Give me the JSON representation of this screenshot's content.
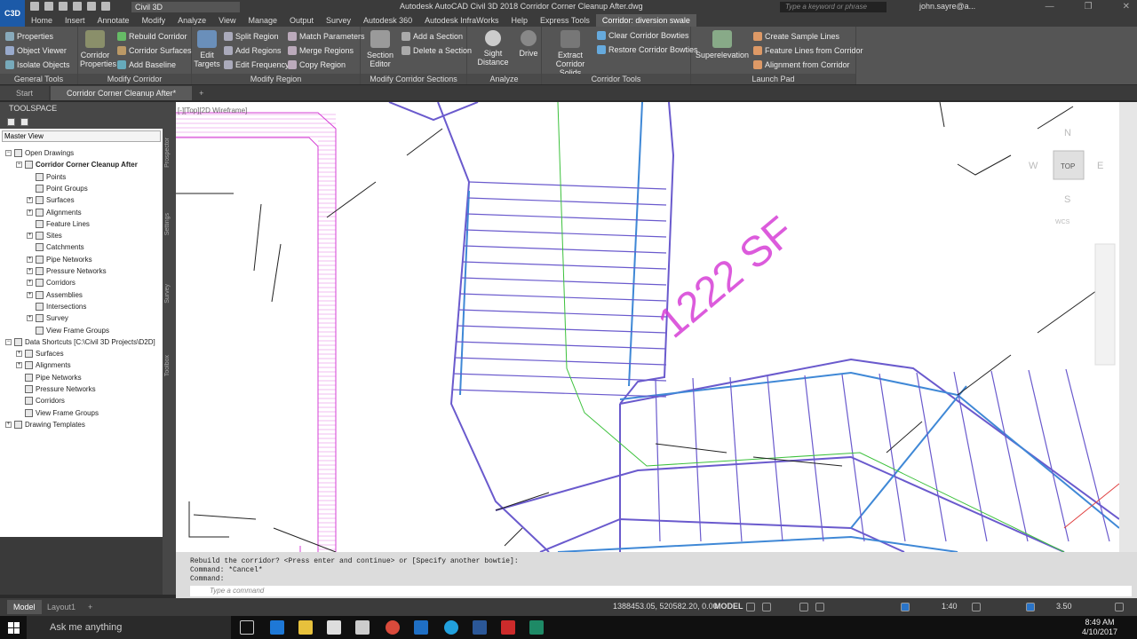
{
  "window": {
    "app_button": "C3D",
    "workspace": "Civil 3D",
    "title": "Autodesk AutoCAD Civil 3D 2018    Corridor Corner Cleanup After.dwg",
    "search_placeholder": "Type a keyword or phrase",
    "user": "john.sayre@a...",
    "controls": [
      "—",
      "❐",
      "✕"
    ]
  },
  "ribbon_tabs": [
    "Home",
    "Insert",
    "Annotate",
    "Modify",
    "Analyze",
    "View",
    "Manage",
    "Output",
    "Survey",
    "Autodesk 360",
    "Autodesk InfraWorks",
    "Help",
    "Express Tools",
    "Corridor: diversion swale"
  ],
  "active_ribbon_tab": "Corridor: diversion swale",
  "ribbon": {
    "general_tools": {
      "title": "General Tools",
      "items": [
        "Properties",
        "Object Viewer",
        "Isolate Objects"
      ]
    },
    "modify_corridor": {
      "title": "Modify Corridor",
      "big": "Corridor Properties",
      "items": [
        "Rebuild Corridor",
        "Corridor Surfaces",
        "Add Baseline"
      ]
    },
    "modify_region": {
      "title": "Modify Region",
      "big": "Edit Targets",
      "items": [
        "Split Region",
        "Add Regions",
        "Edit Frequency",
        "Match Parameters",
        "Merge Regions",
        "Copy Region"
      ]
    },
    "modify_sections": {
      "title": "Modify Corridor Sections",
      "big": "Section Editor",
      "items": [
        "Add a Section",
        "Delete a Section"
      ]
    },
    "analyze": {
      "title": "Analyze",
      "items": [
        "Sight Distance",
        "Drive"
      ]
    },
    "corridor_tools": {
      "title": "Corridor Tools",
      "big": "Extract Corridor Solids",
      "items": [
        "Clear Corridor Bowties",
        "Restore Corridor Bowties"
      ]
    },
    "launch_pad": {
      "title": "Launch Pad",
      "big": "Superelevation",
      "items": [
        "Create Sample Lines",
        "Feature Lines from Corridor",
        "Alignment from Corridor"
      ]
    }
  },
  "file_tabs": [
    "Start",
    "Corridor Corner Cleanup After*"
  ],
  "toolspace": {
    "title": "TOOLSPACE",
    "view": "Master View",
    "tree": [
      {
        "label": "Open Drawings",
        "level": 0,
        "expander": "−"
      },
      {
        "label": "Corridor Corner Cleanup After",
        "level": 1,
        "expander": "−",
        "bold": true
      },
      {
        "label": "Points",
        "level": 2,
        "expander": ""
      },
      {
        "label": "Point Groups",
        "level": 2,
        "expander": ""
      },
      {
        "label": "Surfaces",
        "level": 2,
        "expander": "+"
      },
      {
        "label": "Alignments",
        "level": 2,
        "expander": "+"
      },
      {
        "label": "Feature Lines",
        "level": 2,
        "expander": ""
      },
      {
        "label": "Sites",
        "level": 2,
        "expander": "+"
      },
      {
        "label": "Catchments",
        "level": 2,
        "expander": ""
      },
      {
        "label": "Pipe Networks",
        "level": 2,
        "expander": "+"
      },
      {
        "label": "Pressure Networks",
        "level": 2,
        "expander": "+"
      },
      {
        "label": "Corridors",
        "level": 2,
        "expander": "+"
      },
      {
        "label": "Assemblies",
        "level": 2,
        "expander": "+"
      },
      {
        "label": "Intersections",
        "level": 2,
        "expander": ""
      },
      {
        "label": "Survey",
        "level": 2,
        "expander": "+"
      },
      {
        "label": "View Frame Groups",
        "level": 2,
        "expander": ""
      },
      {
        "label": "Data Shortcuts [C:\\Civil 3D Projects\\D2D]",
        "level": 0,
        "expander": "−"
      },
      {
        "label": "Surfaces",
        "level": 1,
        "expander": "+"
      },
      {
        "label": "Alignments",
        "level": 1,
        "expander": "+"
      },
      {
        "label": "Pipe Networks",
        "level": 1,
        "expander": ""
      },
      {
        "label": "Pressure Networks",
        "level": 1,
        "expander": ""
      },
      {
        "label": "Corridors",
        "level": 1,
        "expander": ""
      },
      {
        "label": "View Frame Groups",
        "level": 1,
        "expander": ""
      },
      {
        "label": "Drawing Templates",
        "level": 0,
        "expander": "+"
      }
    ],
    "side_tabs": [
      "Prospector",
      "Settings",
      "Survey",
      "Toolbox"
    ]
  },
  "viewport": {
    "label": "[-][Top][2D Wireframe]",
    "area_label": "1222 SF",
    "viewcube": {
      "top": "TOP",
      "n": "N",
      "s": "S",
      "e": "E",
      "w": "W",
      "wcs": "WCS"
    }
  },
  "command": {
    "lines": [
      "Rebuild the corridor? <Press enter and continue> or [Specify another bowtie]:",
      "Command: *Cancel*",
      "Command:"
    ],
    "placeholder": "Type a command"
  },
  "status": {
    "tabs": [
      "Model",
      "Layout1"
    ],
    "coords": "1388453.05, 520582.20, 0.00",
    "mode": "MODEL",
    "scale": "1:40",
    "lineweight": "3.50"
  },
  "taskbar": {
    "search": "Ask me anything",
    "time": "8:49 AM",
    "date": "4/10/2017"
  },
  "colors": {
    "accent": "#1c5aa8",
    "corridor_blue": "#3f88d6",
    "corridor_purple": "#6a5acd",
    "magenta": "#d63fd6",
    "green": "#3cc13c"
  }
}
